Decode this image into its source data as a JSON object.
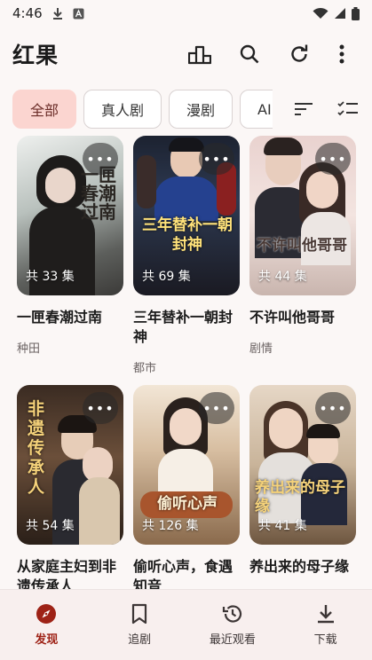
{
  "status": {
    "time": "4:46"
  },
  "appbar": {
    "title": "红果"
  },
  "chips": [
    "全部",
    "真人剧",
    "漫剧",
    "AI"
  ],
  "cards": [
    {
      "title": "一匣春潮过南",
      "genre": "种田",
      "count": "共 33 集",
      "poster_text": "一匣春潮过南"
    },
    {
      "title": "三年替补一朝封神",
      "genre": "都市",
      "count": "共 69 集",
      "poster_text": "三年替补一朝封神"
    },
    {
      "title": "不许叫他哥哥",
      "genre": "剧情",
      "count": "共 44 集",
      "poster_text": "不许叫他哥哥"
    },
    {
      "title": "从家庭主妇到非遗传承人",
      "genre": "",
      "count": "共 54 集",
      "poster_text": "非遗传承人"
    },
    {
      "title": "偷听心声，食遇知音",
      "genre": "",
      "count": "共 126 集",
      "poster_text": "偷听心声"
    },
    {
      "title": "养出来的母子缘",
      "genre": "",
      "count": "共 41 集",
      "poster_text": "养出来的母子缘"
    }
  ],
  "more_label": "•••",
  "bottom_nav": [
    {
      "label": "发现",
      "icon": "compass-icon",
      "active": true
    },
    {
      "label": "追剧",
      "icon": "bookmark-icon",
      "active": false
    },
    {
      "label": "最近观看",
      "icon": "history-icon",
      "active": false
    },
    {
      "label": "下载",
      "icon": "download-icon",
      "active": false
    }
  ],
  "colors": {
    "accent": "#9e2216",
    "chip_active_bg": "#fbd5d0",
    "background": "#fbf7f6"
  }
}
